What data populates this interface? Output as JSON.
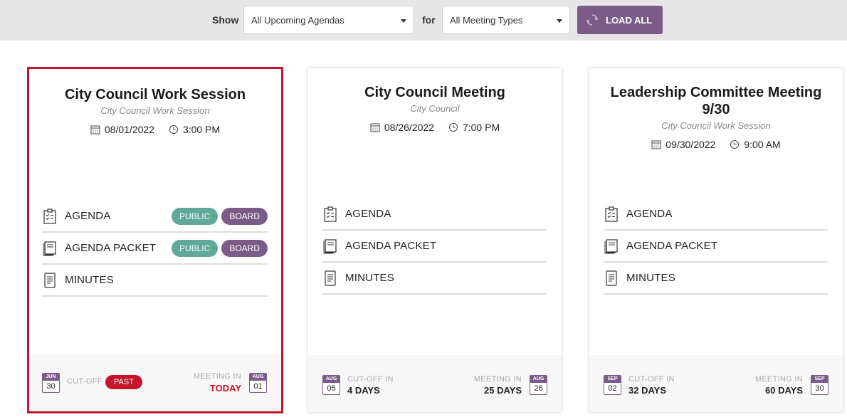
{
  "filter": {
    "show_label": "Show",
    "agenda_select": "All Upcoming Agendas",
    "for_label": "for",
    "type_select": "All Meeting Types",
    "load_label": "LOAD ALL"
  },
  "cards": [
    {
      "title": "City Council Work Session",
      "subtitle": "City Council Work Session",
      "date": "08/01/2022",
      "time": "3:00 PM",
      "docs": [
        {
          "label": "AGENDA",
          "tags": [
            "PUBLIC",
            "BOARD"
          ]
        },
        {
          "label": "AGENDA PACKET",
          "tags": [
            "PUBLIC",
            "BOARD"
          ]
        },
        {
          "label": "MINUTES",
          "tags": []
        }
      ],
      "cutoff": {
        "mon": "JUN",
        "day": "30",
        "label": "CUT-OFF",
        "badge": "PAST"
      },
      "meeting": {
        "label": "MEETING IN",
        "value": "TODAY",
        "mon": "AUG",
        "day": "01"
      }
    },
    {
      "title": "City Council Meeting",
      "subtitle": "City Council",
      "date": "08/26/2022",
      "time": "7:00 PM",
      "docs": [
        {
          "label": "AGENDA",
          "tags": []
        },
        {
          "label": "AGENDA PACKET",
          "tags": []
        },
        {
          "label": "MINUTES",
          "tags": []
        }
      ],
      "cutoff": {
        "mon": "AUG",
        "day": "05",
        "label": "CUT-OFF IN",
        "value": "4 DAYS"
      },
      "meeting": {
        "label": "MEETING IN",
        "value": "25 DAYS",
        "mon": "AUG",
        "day": "26"
      }
    },
    {
      "title": "Leadership Committee Meeting 9/30",
      "subtitle": "City Council Work Session",
      "date": "09/30/2022",
      "time": "9:00 AM",
      "docs": [
        {
          "label": "AGENDA",
          "tags": []
        },
        {
          "label": "AGENDA PACKET",
          "tags": []
        },
        {
          "label": "MINUTES",
          "tags": []
        }
      ],
      "cutoff": {
        "mon": "SEP",
        "day": "02",
        "label": "CUT-OFF IN",
        "value": "32 DAYS"
      },
      "meeting": {
        "label": "MEETING IN",
        "value": "60 DAYS",
        "mon": "SEP",
        "day": "30"
      }
    }
  ],
  "icons": {
    "calendar": "calendar-icon",
    "clock": "clock-icon",
    "agenda": "checklist-icon",
    "packet": "book-icon",
    "minutes": "document-icon",
    "reload": "refresh-icon"
  },
  "colors": {
    "accent": "#7b5b88",
    "public": "#5fa89a",
    "danger": "#c4162a"
  }
}
